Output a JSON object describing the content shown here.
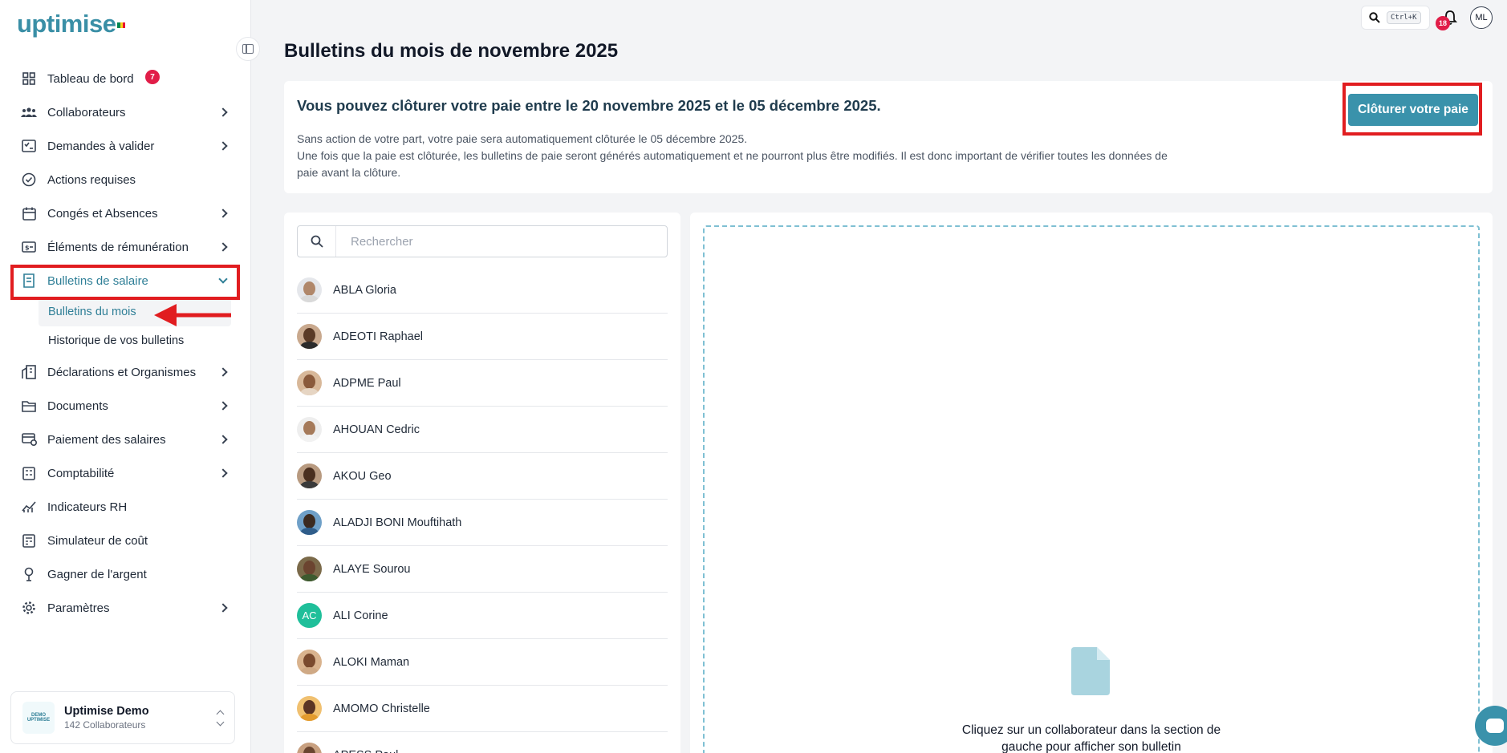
{
  "app": {
    "logo_text": "uptimise"
  },
  "sidebar": {
    "items": [
      {
        "label": "Tableau de bord",
        "icon": "dashboard-icon"
      },
      {
        "label": "Collaborateurs",
        "icon": "users-icon"
      },
      {
        "label": "Demandes à valider",
        "icon": "checklist-icon",
        "badge": "7"
      },
      {
        "label": "Actions requises",
        "icon": "check-circle-icon"
      },
      {
        "label": "Congés et Absences",
        "icon": "calendar-icon"
      },
      {
        "label": "Éléments de rémunération",
        "icon": "money-icon"
      },
      {
        "label": "Bulletins de salaire",
        "icon": "payslip-icon"
      },
      {
        "label": "Déclarations et Organismes",
        "icon": "building-icon"
      },
      {
        "label": "Documents",
        "icon": "folder-icon"
      },
      {
        "label": "Paiement des salaires",
        "icon": "payment-icon"
      },
      {
        "label": "Comptabilité",
        "icon": "calculator-icon"
      },
      {
        "label": "Indicateurs RH",
        "icon": "chart-icon"
      },
      {
        "label": "Simulateur de coût",
        "icon": "simulator-icon"
      },
      {
        "label": "Gagner de l'argent",
        "icon": "award-icon"
      },
      {
        "label": "Paramètres",
        "icon": "gear-icon"
      }
    ],
    "sub_items": [
      {
        "label": "Bulletins du mois"
      },
      {
        "label": "Historique de vos bulletins"
      }
    ],
    "company": {
      "name": "Uptimise Demo",
      "subtitle": "142 Collaborateurs",
      "logo_top": "DEMO",
      "logo_bottom": "UPTIMISE"
    }
  },
  "topbar": {
    "shortcut": "Ctrl+K",
    "notifications": "18",
    "avatar": "ML"
  },
  "main": {
    "title": "Bulletins du mois de novembre 2025",
    "info": {
      "title": "Vous pouvez clôturer votre paie entre le 20 novembre 2025 et le 05 décembre 2025.",
      "line1": "Sans action de votre part, votre paie sera automatiquement clôturée le 05 décembre 2025.",
      "line2": "Une fois que la paie est clôturée, les bulletins de paie seront générés automatiquement et ne pourront plus être modifiés. Il est donc important de vérifier toutes les données de paie avant la clôture.",
      "button": "Clôturer votre paie"
    },
    "search": {
      "placeholder": "Rechercher"
    },
    "employees": [
      {
        "name": "ABLA Gloria",
        "skin": "#b0876a",
        "shirt": "#d9d9d9",
        "bg": "#e5e7eb"
      },
      {
        "name": "ADEOTI Raphael",
        "skin": "#5a3a26",
        "shirt": "#2b2b2b",
        "bg": "#c9a98e"
      },
      {
        "name": "ADPME Paul",
        "skin": "#8a5a3b",
        "shirt": "#e6d5c3",
        "bg": "#d8b899"
      },
      {
        "name": "AHOUAN Cedric",
        "skin": "#a57a5a",
        "shirt": "#f2f2f2",
        "bg": "#eeeeee"
      },
      {
        "name": "AKOU Geo",
        "skin": "#4a2f1f",
        "shirt": "#3a3a3a",
        "bg": "#b89a80"
      },
      {
        "name": "ALADJI BONI Mouftihath",
        "skin": "#3b2a20",
        "shirt": "#2f5d8a",
        "bg": "#6fa0c8"
      },
      {
        "name": "ALAYE Sourou",
        "skin": "#6b4430",
        "shirt": "#3d5a2f",
        "bg": "#7b6a4a"
      },
      {
        "name": "ALI Corine",
        "initials": "AC"
      },
      {
        "name": "ALOKI Maman",
        "skin": "#7a4a2e",
        "shirt": "#cfa985",
        "bg": "#d9b38e"
      },
      {
        "name": "AMOMO Christelle",
        "skin": "#5b3424",
        "shirt": "#e39b2e",
        "bg": "#f0c070"
      },
      {
        "name": "APESS Paul",
        "skin": "#6a4530",
        "shirt": "#333333",
        "bg": "#c8a080"
      }
    ],
    "preview": {
      "line1": "Cliquez sur un collaborateur dans la section de",
      "line2": "gauche pour afficher son bulletin"
    }
  },
  "colors": {
    "brand": "#3a92ab",
    "annotation": "#e11d20",
    "badge": "#e11d48"
  }
}
